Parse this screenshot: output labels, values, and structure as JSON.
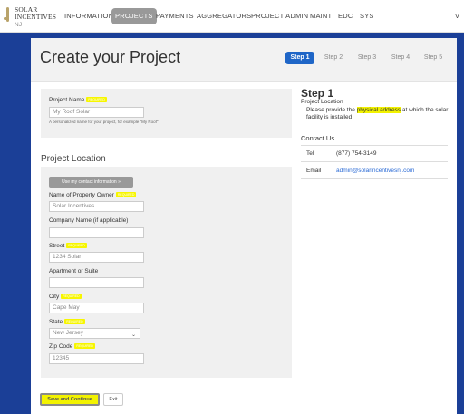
{
  "brand": {
    "name_line1": "SOLAR",
    "name_line2": "INCENTIVES",
    "suffix": "NJ"
  },
  "nav": {
    "items": [
      {
        "label": "INFORMATION"
      },
      {
        "label": "PROJECTS",
        "active": true
      },
      {
        "label": "PAYMENTS"
      },
      {
        "label": "AGGREGATORS"
      },
      {
        "label": "PROJECT ADMIN"
      },
      {
        "label": "MAINT"
      },
      {
        "label": "EDC"
      },
      {
        "label": "SYS"
      },
      {
        "label": "V"
      }
    ]
  },
  "page": {
    "title": "Create your Project"
  },
  "steps": [
    {
      "label": "Step 1",
      "active": true
    },
    {
      "label": "Step 2"
    },
    {
      "label": "Step 3"
    },
    {
      "label": "Step 4"
    },
    {
      "label": "Step 5"
    }
  ],
  "required_badge": "REQUIRED",
  "project_name": {
    "label": "Project Name",
    "value": "My Roof Solar",
    "help": "A personalized name for your project, for example \"My Roof\""
  },
  "project_location": {
    "title": "Project Location",
    "contact_button": "Use my contact information »",
    "owner": {
      "label": "Name of Property Owner",
      "value": "Solar Incentives"
    },
    "company": {
      "label": "Company Name (if applicable)",
      "value": ""
    },
    "street": {
      "label": "Street",
      "value": "1234 Solar"
    },
    "apartment": {
      "label": "Apartment or Suite",
      "value": ""
    },
    "city": {
      "label": "City",
      "value": "Cape May"
    },
    "state": {
      "label": "State",
      "value": "New Jersey"
    },
    "zip": {
      "label": "Zip Code",
      "value": "12345"
    }
  },
  "sidebar": {
    "step_title": "Step 1",
    "step_subtitle": "Project Location",
    "desc_pre": "Please provide the ",
    "desc_highlight": "physical address",
    "desc_post": " at which the solar facility is installed",
    "contact_title": "Contact Us",
    "tel_label": "Tel",
    "tel_value": "(877) 754-3149",
    "email_label": "Email",
    "email_value": "admin@solarincentivesnj.com"
  },
  "actions": {
    "save": "Save and Continue",
    "exit": "Exit"
  },
  "colors": {
    "nav_bg": "#ffffff",
    "page_bg": "#1b3f97",
    "step_active": "#1f66c7",
    "highlight": "#f2f200"
  }
}
